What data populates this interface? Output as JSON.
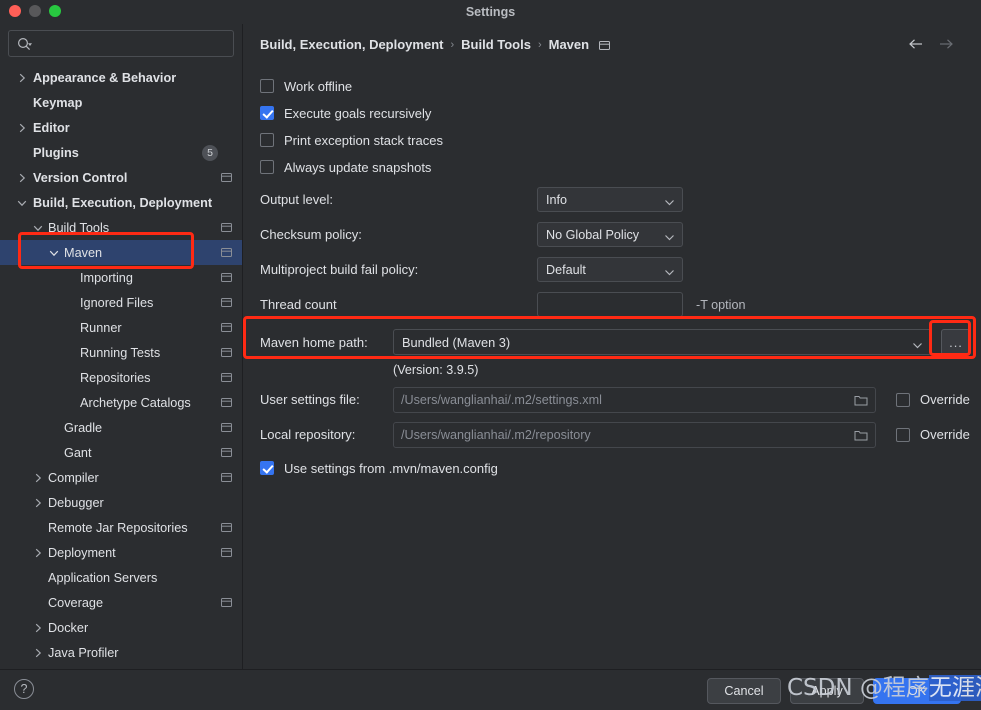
{
  "window": {
    "title": "Settings",
    "traffic_lights": [
      "close-red",
      "minimize-yellow",
      "zoom-green"
    ]
  },
  "sidebar": {
    "search": {
      "value": "",
      "placeholder": "",
      "icon": "search-icon"
    },
    "items": [
      {
        "label": "Appearance & Behavior",
        "depth": 0,
        "chevron": "right",
        "bold": true,
        "mod_icon": false,
        "badge": null,
        "selected": false
      },
      {
        "label": "Keymap",
        "depth": 0,
        "chevron": "none",
        "bold": true,
        "mod_icon": false,
        "badge": null,
        "selected": false
      },
      {
        "label": "Editor",
        "depth": 0,
        "chevron": "right",
        "bold": true,
        "mod_icon": false,
        "badge": null,
        "selected": false
      },
      {
        "label": "Plugins",
        "depth": 0,
        "chevron": "none",
        "bold": true,
        "mod_icon": false,
        "badge": "5",
        "selected": false
      },
      {
        "label": "Version Control",
        "depth": 0,
        "chevron": "right",
        "bold": true,
        "mod_icon": true,
        "badge": null,
        "selected": false
      },
      {
        "label": "Build, Execution, Deployment",
        "depth": 0,
        "chevron": "down",
        "bold": true,
        "mod_icon": false,
        "badge": null,
        "selected": false
      },
      {
        "label": "Build Tools",
        "depth": 1,
        "chevron": "down",
        "bold": false,
        "mod_icon": true,
        "badge": null,
        "selected": false
      },
      {
        "label": "Maven",
        "depth": 2,
        "chevron": "down",
        "bold": false,
        "mod_icon": true,
        "badge": null,
        "selected": true
      },
      {
        "label": "Importing",
        "depth": 3,
        "chevron": "none",
        "bold": false,
        "mod_icon": true,
        "badge": null,
        "selected": false
      },
      {
        "label": "Ignored Files",
        "depth": 3,
        "chevron": "none",
        "bold": false,
        "mod_icon": true,
        "badge": null,
        "selected": false
      },
      {
        "label": "Runner",
        "depth": 3,
        "chevron": "none",
        "bold": false,
        "mod_icon": true,
        "badge": null,
        "selected": false
      },
      {
        "label": "Running Tests",
        "depth": 3,
        "chevron": "none",
        "bold": false,
        "mod_icon": true,
        "badge": null,
        "selected": false
      },
      {
        "label": "Repositories",
        "depth": 3,
        "chevron": "none",
        "bold": false,
        "mod_icon": true,
        "badge": null,
        "selected": false
      },
      {
        "label": "Archetype Catalogs",
        "depth": 3,
        "chevron": "none",
        "bold": false,
        "mod_icon": true,
        "badge": null,
        "selected": false
      },
      {
        "label": "Gradle",
        "depth": 2,
        "chevron": "none",
        "bold": false,
        "mod_icon": true,
        "badge": null,
        "selected": false
      },
      {
        "label": "Gant",
        "depth": 2,
        "chevron": "none",
        "bold": false,
        "mod_icon": true,
        "badge": null,
        "selected": false
      },
      {
        "label": "Compiler",
        "depth": 1,
        "chevron": "right",
        "bold": false,
        "mod_icon": true,
        "badge": null,
        "selected": false
      },
      {
        "label": "Debugger",
        "depth": 1,
        "chevron": "right",
        "bold": false,
        "mod_icon": false,
        "badge": null,
        "selected": false
      },
      {
        "label": "Remote Jar Repositories",
        "depth": 1,
        "chevron": "none",
        "bold": false,
        "mod_icon": true,
        "badge": null,
        "selected": false
      },
      {
        "label": "Deployment",
        "depth": 1,
        "chevron": "right",
        "bold": false,
        "mod_icon": true,
        "badge": null,
        "selected": false
      },
      {
        "label": "Application Servers",
        "depth": 1,
        "chevron": "none",
        "bold": false,
        "mod_icon": false,
        "badge": null,
        "selected": false
      },
      {
        "label": "Coverage",
        "depth": 1,
        "chevron": "none",
        "bold": false,
        "mod_icon": true,
        "badge": null,
        "selected": false
      },
      {
        "label": "Docker",
        "depth": 1,
        "chevron": "right",
        "bold": false,
        "mod_icon": false,
        "badge": null,
        "selected": false
      },
      {
        "label": "Java Profiler",
        "depth": 1,
        "chevron": "right",
        "bold": false,
        "mod_icon": false,
        "badge": null,
        "selected": false
      }
    ]
  },
  "content": {
    "breadcrumb": {
      "parts": [
        "Build, Execution, Deployment",
        "Build Tools",
        "Maven"
      ],
      "separator": "›",
      "trailing_icon": "project-settings-icon"
    },
    "nav": {
      "back_icon": "arrow-left-icon",
      "forward_icon": "arrow-right-icon"
    },
    "checkboxes": [
      {
        "label": "Work offline",
        "checked": false
      },
      {
        "label": "Execute goals recursively",
        "checked": true
      },
      {
        "label": "Print exception stack traces",
        "checked": false
      },
      {
        "label": "Always update snapshots",
        "checked": false
      }
    ],
    "selects": [
      {
        "label": "Output level:",
        "value": "Info"
      },
      {
        "label": "Checksum policy:",
        "value": "No Global Policy"
      },
      {
        "label": "Multiproject build fail policy:",
        "value": "Default"
      }
    ],
    "thread_count": {
      "label": "Thread count",
      "value": "",
      "placeholder": "",
      "hint": "-T option"
    },
    "maven_home": {
      "label": "Maven home path:",
      "value": "Bundled (Maven 3)",
      "browse_button": "...",
      "version_text": "(Version: 3.9.5)"
    },
    "paths": [
      {
        "label": "User settings file:",
        "placeholder": "/Users/wanglianhai/.m2/settings.xml",
        "value": "",
        "override_label": "Override",
        "override_checked": false
      },
      {
        "label": "Local repository:",
        "placeholder": "/Users/wanglianhai/.m2/repository",
        "value": "",
        "override_label": "Override",
        "override_checked": false
      }
    ],
    "mvn_config": {
      "label": "Use settings from .mvn/maven.config",
      "checked": true
    }
  },
  "bottom": {
    "help_icon": "?",
    "cancel_label": "Cancel",
    "apply_label": "Apply",
    "ok_label": "OK"
  },
  "watermark": {
    "prefix": "CSDN @程序",
    "selected": "无涯海"
  },
  "colors": {
    "accent": "#3574f0",
    "selection": "#2e436e",
    "annotation": "#ff2a14",
    "background": "#2b2d30"
  }
}
